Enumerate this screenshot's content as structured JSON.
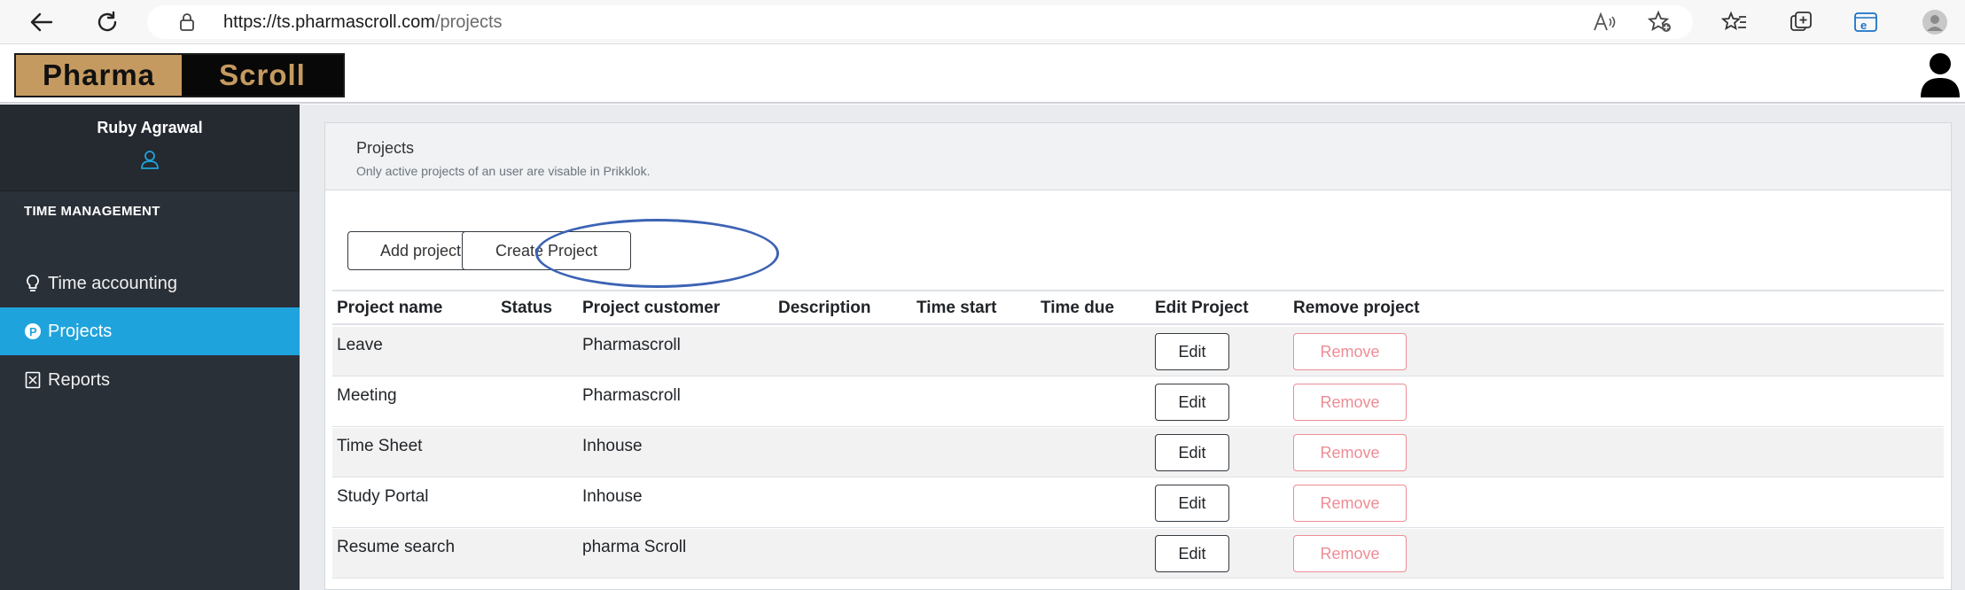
{
  "browser": {
    "url_host": "https://ts.pharmascroll.com",
    "url_path": "/projects"
  },
  "logo": {
    "part1": "Pharma",
    "part2": "Scroll"
  },
  "sidebar": {
    "user_name": "Ruby Agrawal",
    "section": "TIME MANAGEMENT",
    "items": [
      {
        "label": "Time accounting",
        "icon": "lightbulb-icon"
      },
      {
        "label": "Projects",
        "icon": "p-circle-icon",
        "active": true
      },
      {
        "label": "Reports",
        "icon": "report-icon"
      }
    ]
  },
  "card": {
    "title": "Projects",
    "subtitle": "Only active projects of an user are visable in Prikklok.",
    "add_button": "Add project",
    "create_button": "Create Project"
  },
  "table": {
    "headers": [
      "Project name",
      "Status",
      "Project customer",
      "Description",
      "Time start",
      "Time due",
      "Edit Project",
      "Remove project"
    ],
    "rows": [
      {
        "name": "Leave",
        "status": "",
        "customer": "Pharmascroll",
        "description": "",
        "start": "",
        "due": ""
      },
      {
        "name": "Meeting",
        "status": "",
        "customer": "Pharmascroll",
        "description": "",
        "start": "",
        "due": ""
      },
      {
        "name": "Time Sheet",
        "status": "",
        "customer": "Inhouse",
        "description": "",
        "start": "",
        "due": ""
      },
      {
        "name": "Study Portal",
        "status": "",
        "customer": "Inhouse",
        "description": "",
        "start": "",
        "due": ""
      },
      {
        "name": "Resume search",
        "status": "",
        "customer": "pharma Scroll",
        "description": "",
        "start": "",
        "due": ""
      }
    ],
    "edit_label": "Edit",
    "remove_label": "Remove"
  },
  "colors": {
    "sidebar_bg": "#2a3038",
    "active_nav": "#1fa3dc",
    "remove_red": "#ee8c95",
    "highlight_circle": "#3c63b5",
    "logo_gold": "#c59a60"
  }
}
